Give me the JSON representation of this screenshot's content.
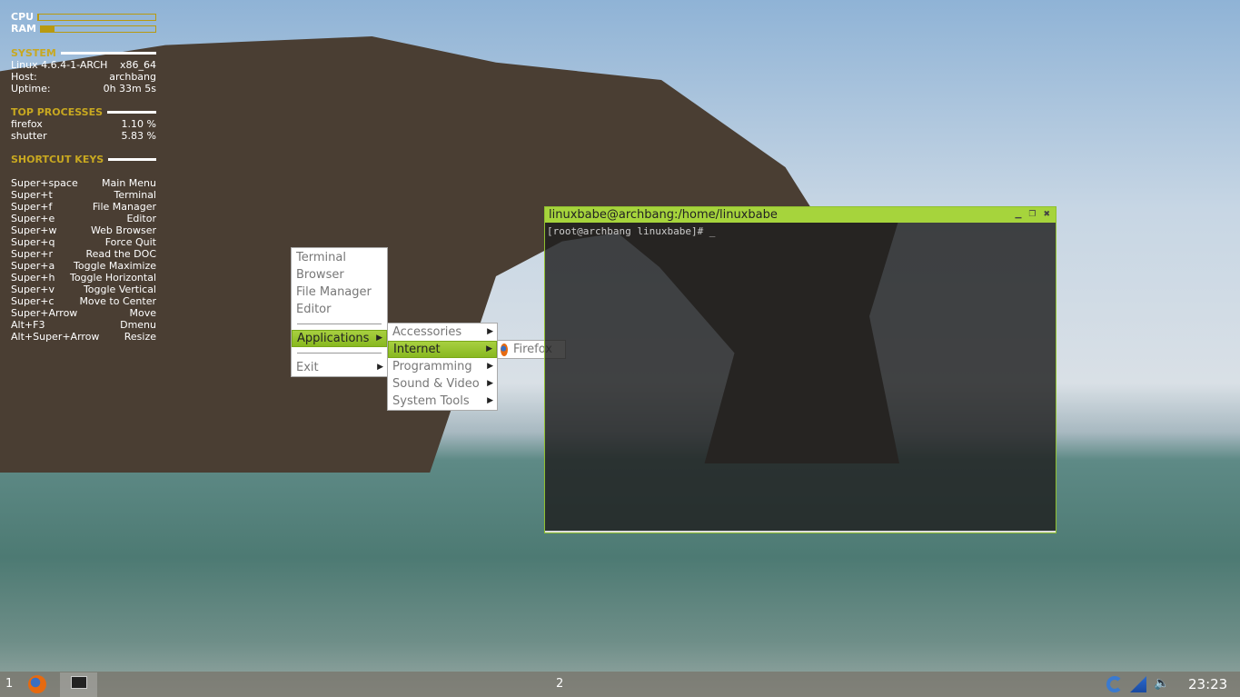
{
  "conky": {
    "cpu_label": "CPU",
    "ram_label": "RAM",
    "cpu_percent": 1,
    "ram_percent": 7,
    "system_heading": "SYSTEM",
    "kernel": "Linux 4.6.4-1-ARCH",
    "arch": "x86_64",
    "host_label": "Host:",
    "host": "archbang",
    "uptime_label": "Uptime:",
    "uptime": "0h 33m 5s",
    "processes_heading": "TOP PROCESSES",
    "processes": [
      {
        "name": "firefox",
        "cpu": "1.10 %"
      },
      {
        "name": "shutter",
        "cpu": "5.83 %"
      }
    ],
    "shortcuts_heading": "SHORTCUT KEYS",
    "shortcuts": [
      {
        "key": "Super+space",
        "action": "Main Menu"
      },
      {
        "key": "Super+t",
        "action": "Terminal"
      },
      {
        "key": "Super+f",
        "action": "File Manager"
      },
      {
        "key": "Super+e",
        "action": "Editor"
      },
      {
        "key": "Super+w",
        "action": "Web Browser"
      },
      {
        "key": "Super+q",
        "action": "Force Quit"
      },
      {
        "key": "Super+r",
        "action": "Read the DOC"
      },
      {
        "key": "Super+a",
        "action": "Toggle Maximize"
      },
      {
        "key": "Super+h",
        "action": "Toggle Horizontal"
      },
      {
        "key": "Super+v",
        "action": "Toggle Vertical"
      },
      {
        "key": "Super+c",
        "action": "Move to Center"
      },
      {
        "key": "Super+Arrow",
        "action": "Move"
      },
      {
        "key": "Alt+F3",
        "action": "Dmenu"
      },
      {
        "key": "Alt+Super+Arrow",
        "action": "Resize"
      }
    ]
  },
  "menu": {
    "items": [
      "Terminal",
      "Browser",
      "File Manager",
      "Editor"
    ],
    "applications": "Applications",
    "exit": "Exit",
    "submenu": [
      "Accessories",
      "Internet",
      "Programming",
      "Sound & Video",
      "System Tools"
    ],
    "internet_items": [
      "Firefox"
    ]
  },
  "terminal": {
    "title": "linuxbabe@archbang:/home/linuxbabe",
    "prompt": "[root@archbang linuxbabe]# _"
  },
  "panel": {
    "desktop1": "1",
    "desktop2": "2",
    "clock": "23:23"
  },
  "colors": {
    "accent": "#a6d43c",
    "conky_heading": "#c8a820"
  }
}
